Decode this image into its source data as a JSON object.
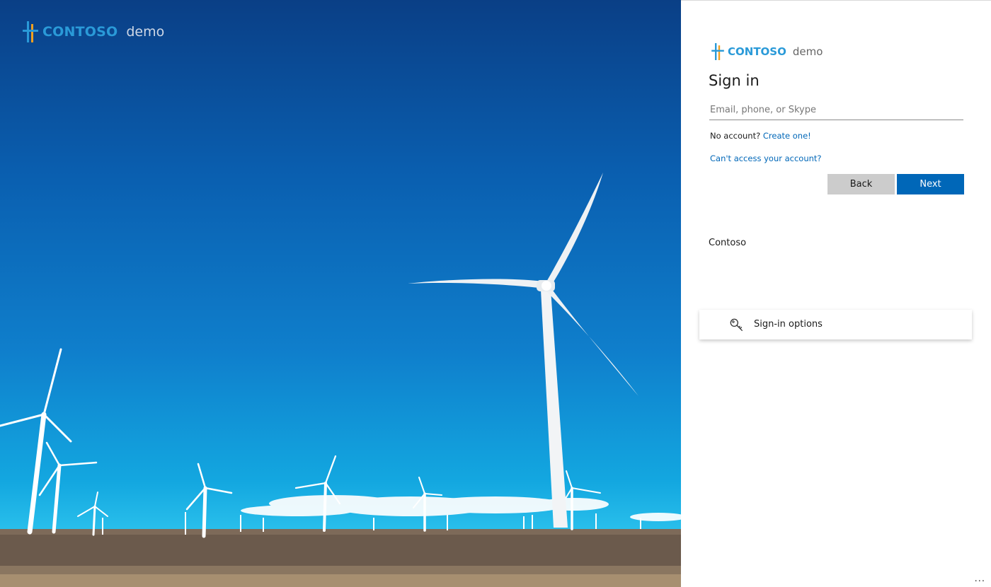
{
  "hero": {
    "brand": "CONTOSO",
    "brand_suffix": "demo"
  },
  "signin": {
    "brand": "CONTOSO",
    "brand_suffix": "demo",
    "title": "Sign in",
    "email_placeholder": "Email, phone, or Skype",
    "email_value": "",
    "no_account_text": "No account?",
    "create_link": "Create one!",
    "cant_access_link": "Can't access your account?",
    "back_label": "Back",
    "next_label": "Next",
    "organization": "Contoso",
    "signin_options_label": "Sign-in options",
    "signin_options_icon": "key-icon",
    "more_options_label": "..."
  },
  "colors": {
    "accent": "#0067b8",
    "brand": "#2a9ad8",
    "back_button": "#cccccc"
  }
}
